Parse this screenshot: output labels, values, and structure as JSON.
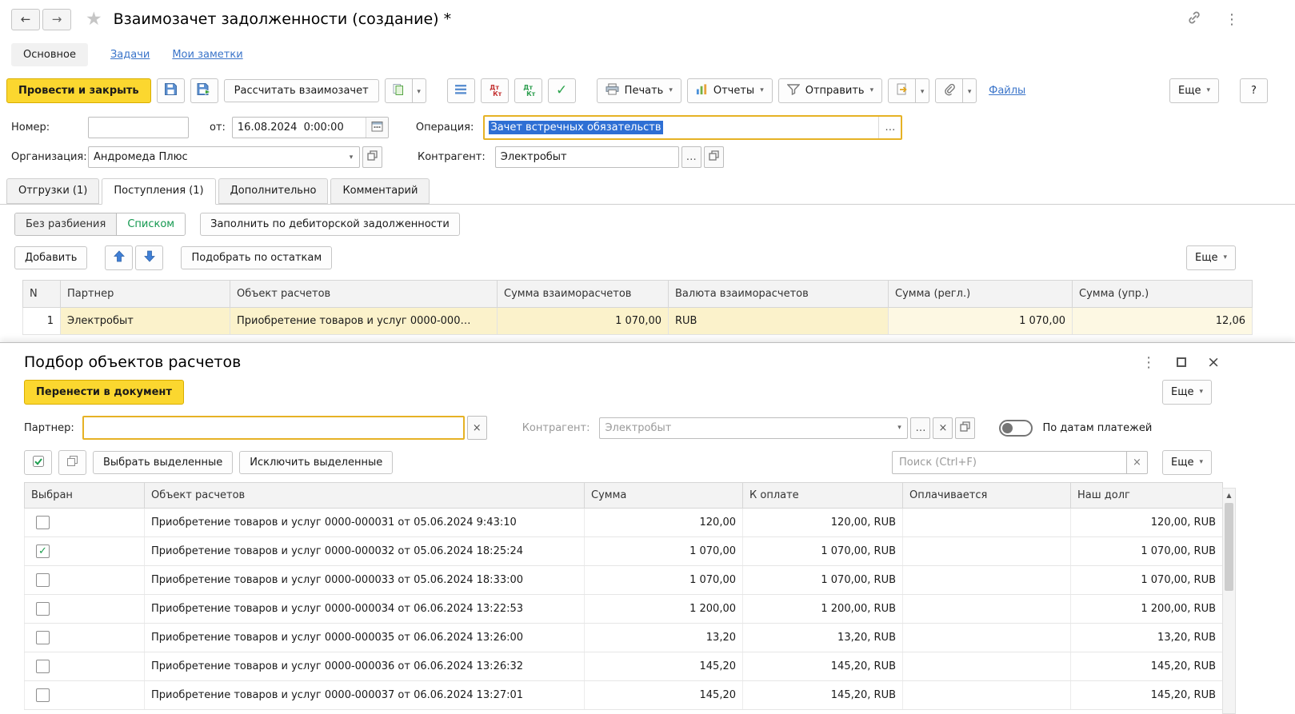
{
  "colors": {
    "accent_yellow": "#FBD72F",
    "link_blue": "#3A74C9",
    "selection_blue": "#2E6FD4",
    "green_check": "#1D9E4F",
    "selected_row": "#FBF2CB"
  },
  "header": {
    "title": "Взаимозачет задолженности (создание) *"
  },
  "nav": {
    "items": [
      {
        "label": "Основное"
      },
      {
        "label": "Задачи"
      },
      {
        "label": "Мои заметки"
      }
    ]
  },
  "toolbar": {
    "post_and_close": "Провести и закрыть",
    "recalculate": "Рассчитать взаимозачет",
    "dt_label": "Дт",
    "kt_label": "Кт",
    "print": "Печать",
    "reports": "Отчеты",
    "send": "Отправить",
    "files": "Файлы",
    "more": "Еще",
    "help": "?"
  },
  "fields": {
    "number": {
      "label": "Номер:",
      "value": ""
    },
    "date": {
      "label": "от:",
      "value": "16.08.2024  0:00:00"
    },
    "operation": {
      "label": "Операция:",
      "value": "Зачет встречных обязательств"
    },
    "organization": {
      "label": "Организация:",
      "value": "Андромеда Плюс"
    },
    "counterparty": {
      "label": "Контрагент:",
      "value": "Электробыт"
    }
  },
  "doc_tabs": {
    "items": [
      "Отгрузки (1)",
      "Поступления (1)",
      "Дополнительно",
      "Комментарий"
    ],
    "active": "Поступления (1)"
  },
  "list_toolbar": {
    "no_split": "Без разбиения",
    "as_list": "Списком",
    "fill_by_receivables": "Заполнить по дебиторской задолженности",
    "add": "Добавить",
    "pick_by_balances": "Подобрать по остаткам",
    "more": "Еще"
  },
  "main_table": {
    "headers": [
      "N",
      "Партнер",
      "Объект расчетов",
      "Сумма взаиморасчетов",
      "Валюта взаиморасчетов",
      "Сумма (регл.)",
      "Сумма (упр.)"
    ],
    "rows": [
      {
        "n": "1",
        "partner": "Электробыт",
        "object": "Приобретение товаров и услуг 0000-000…",
        "amount": "1 070,00",
        "currency": "RUB",
        "amount_reg": "1 070,00",
        "amount_mgmt": "12,06"
      }
    ]
  },
  "picker": {
    "title": "Подбор объектов расчетов",
    "transfer": "Перенести в документ",
    "more": "Еще",
    "partner": {
      "label": "Партнер:",
      "value": ""
    },
    "counterparty": {
      "label": "Контрагент:",
      "value": "Электробыт"
    },
    "by_payment_dates": "По датам платежей",
    "select_highlighted": "Выбрать выделенные",
    "exclude_highlighted": "Исключить выделенные",
    "search_placeholder": "Поиск (Ctrl+F)",
    "table": {
      "headers": [
        "Выбран",
        "Объект расчетов",
        "Сумма",
        "К оплате",
        "Оплачивается",
        "Наш долг"
      ],
      "rows": [
        {
          "checked": false,
          "object": "Приобретение товаров и услуг 0000-000031 от 05.06.2024 9:43:10",
          "amount": "120,00",
          "to_pay": "120,00, RUB",
          "paying": "",
          "our_debt": "120,00, RUB"
        },
        {
          "checked": true,
          "object": "Приобретение товаров и услуг 0000-000032 от 05.06.2024 18:25:24",
          "amount": "1 070,00",
          "to_pay": "1 070,00, RUB",
          "paying": "",
          "our_debt": "1 070,00, RUB"
        },
        {
          "checked": false,
          "object": "Приобретение товаров и услуг 0000-000033 от 05.06.2024 18:33:00",
          "amount": "1 070,00",
          "to_pay": "1 070,00, RUB",
          "paying": "",
          "our_debt": "1 070,00, RUB"
        },
        {
          "checked": false,
          "object": "Приобретение товаров и услуг 0000-000034 от 06.06.2024 13:22:53",
          "amount": "1 200,00",
          "to_pay": "1 200,00, RUB",
          "paying": "",
          "our_debt": "1 200,00, RUB"
        },
        {
          "checked": false,
          "object": "Приобретение товаров и услуг 0000-000035 от 06.06.2024 13:26:00",
          "amount": "13,20",
          "to_pay": "13,20, RUB",
          "paying": "",
          "our_debt": "13,20, RUB"
        },
        {
          "checked": false,
          "object": "Приобретение товаров и услуг 0000-000036 от 06.06.2024 13:26:32",
          "amount": "145,20",
          "to_pay": "145,20, RUB",
          "paying": "",
          "our_debt": "145,20, RUB"
        },
        {
          "checked": false,
          "object": "Приобретение товаров и услуг 0000-000037 от 06.06.2024 13:27:01",
          "amount": "145,20",
          "to_pay": "145,20, RUB",
          "paying": "",
          "our_debt": "145,20, RUB"
        }
      ]
    }
  }
}
